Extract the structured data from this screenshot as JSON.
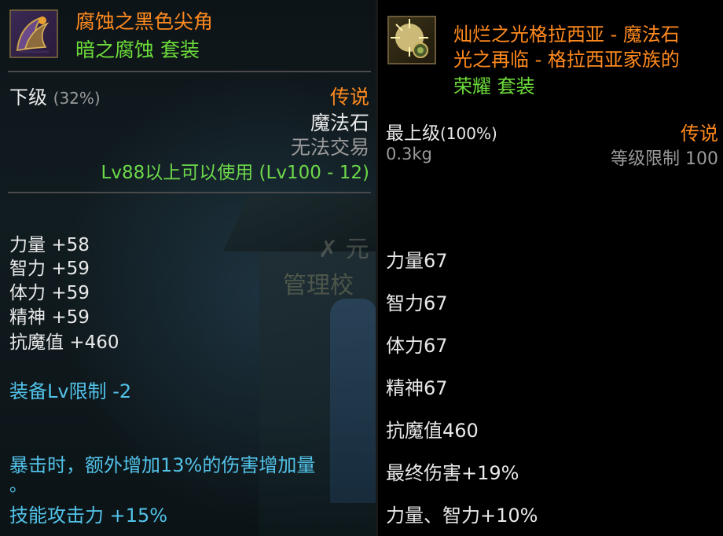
{
  "left": {
    "item_name": "腐蚀之黑色尖角",
    "set_name": "暗之腐蚀  套装",
    "grade": "下级",
    "grade_pct": "(32%)",
    "rarity": "传说",
    "type": "魔法石",
    "trade": "无法交易",
    "level_req": "Lv88以上可以使用 (Lv100 - 12)",
    "stats": [
      {
        "name": "力量",
        "value": "+58"
      },
      {
        "name": "智力",
        "value": "+59"
      },
      {
        "name": "体力",
        "value": "+59"
      },
      {
        "name": "精神",
        "value": "+59"
      },
      {
        "name": "抗魔值",
        "value": "+460"
      }
    ],
    "equip_lv": "装备Lv限制 -2",
    "effect_line1": "暴击时，额外增加13%的伤害增加量",
    "effect_line2": "。",
    "effect_line3": "技能攻击力 +15%",
    "bg_sign": "管理校",
    "bg_sign2": "✗ 元"
  },
  "right": {
    "item_name_line1": "灿烂之光格拉西亚 - 魔法石",
    "item_name_line2": "光之再临 - 格拉西亚家族的",
    "item_name_line3": "荣耀 套装",
    "grade": "最上级",
    "grade_pct": "(100%)",
    "rarity": "传说",
    "weight": "0.3kg",
    "level_limit": "等级限制 100",
    "stats": [
      "力量67",
      "智力67",
      "体力67",
      "精神67",
      "抗魔值460",
      "最终伤害+19%",
      "力量、智力+10%"
    ]
  },
  "colors": {
    "name": "#ff8a1e",
    "set": "#6ddc3a",
    "effect": "#52c2e8"
  },
  "icons": {
    "left": "dark-horn-icon",
    "right": "radiant-stone-icon"
  }
}
